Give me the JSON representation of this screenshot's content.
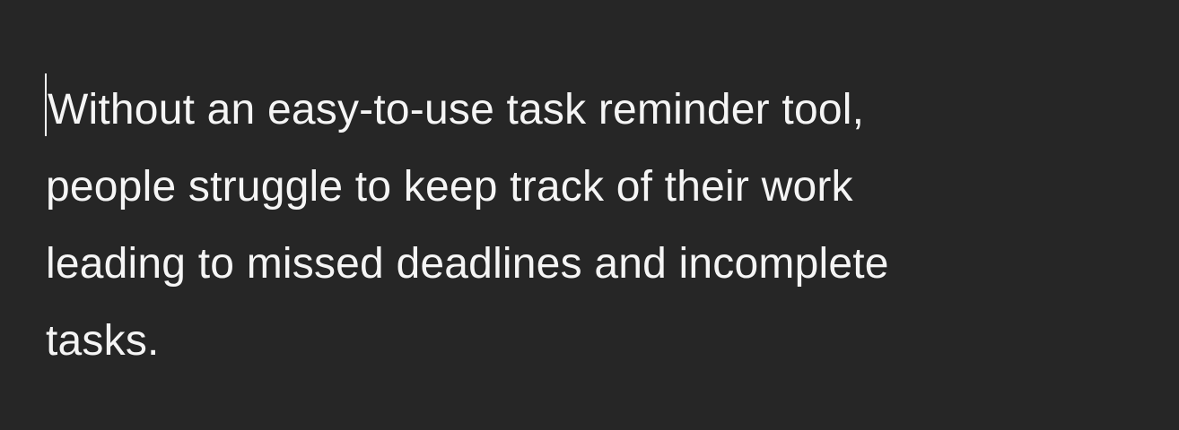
{
  "document": {
    "lines": [
      "Without an easy-to-use task reminder tool,",
      "people struggle to keep track of their work",
      "leading to missed deadlines and incomplete",
      "tasks."
    ]
  },
  "colors": {
    "background": "#262626",
    "text": "#f5f5f5"
  }
}
